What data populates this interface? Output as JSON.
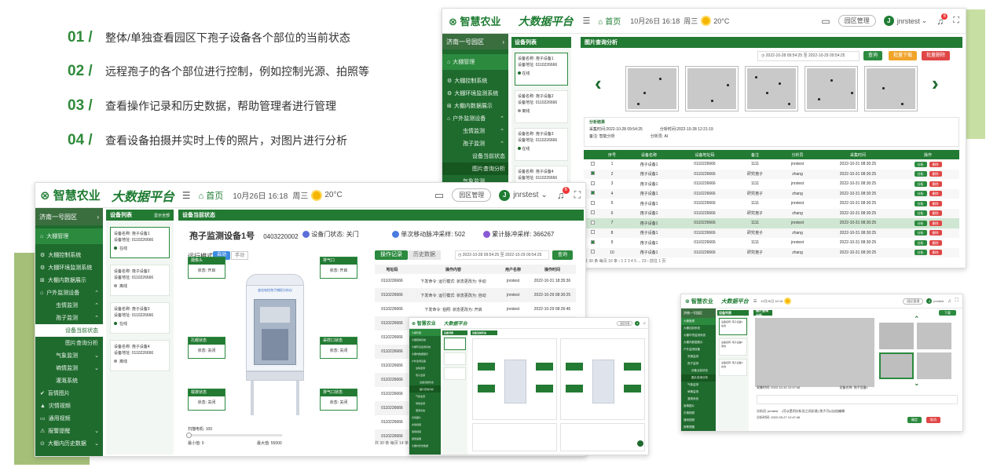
{
  "features": [
    {
      "num": "01 /",
      "text": "整体/单独查看园区下孢子设备各个部位的当前状态"
    },
    {
      "num": "02 /",
      "text": "远程孢子的各个部位进行控制，例如控制光源、拍照等"
    },
    {
      "num": "03 /",
      "text": "查看操作记录和历史数据，帮助管理者进行管理"
    },
    {
      "num": "04 /",
      "text": "查看设备拍摄并实时上传的照片，对图片进行分析"
    }
  ],
  "header": {
    "logo": "智慧农业",
    "platform": "大数据平台",
    "home": "首页",
    "date": "10月26日 16:18",
    "weekday": "周三",
    "temp": "20°C",
    "park_btn": "园区管理",
    "user": "jnrstest",
    "avatar": "J",
    "notify_count": "6"
  },
  "sidebar": {
    "park": "济南一号园区",
    "items": [
      {
        "label": "大棚管理",
        "level": 0
      },
      {
        "label": "大棚控制系统",
        "level": 0
      },
      {
        "label": "大棚环境监测系统",
        "level": 0
      },
      {
        "label": "大棚内数据展示",
        "level": 0
      },
      {
        "label": "户外监测设备",
        "level": 0,
        "arrow": "⌃"
      },
      {
        "label": "虫情监测",
        "level": 1,
        "arrow": "⌃"
      },
      {
        "label": "孢子监测",
        "level": 1,
        "arrow": "⌃"
      },
      {
        "label": "设备当前状态",
        "level": 2
      },
      {
        "label": "图片查询分析",
        "level": 2
      },
      {
        "label": "气象监测",
        "level": 1,
        "arrow": "⌄"
      },
      {
        "label": "墒情监测",
        "level": 1,
        "arrow": "⌄"
      },
      {
        "label": "灌溉系统",
        "level": 1
      },
      {
        "label": "盲情图片",
        "level": 0
      },
      {
        "label": "灾情视频",
        "level": 0
      },
      {
        "label": "通用视频",
        "level": 0
      },
      {
        "label": "报警提醒",
        "level": 0,
        "arrow": "⌄"
      },
      {
        "label": "大棚内历史数据",
        "level": 0,
        "arrow": "⌄"
      }
    ]
  },
  "devices": {
    "title": "设备列表",
    "show_all": "显示全部",
    "items": [
      {
        "name": "设备名称: 孢子设备1",
        "addr": "设备地址: 0110226666",
        "status": "在线",
        "online": true
      },
      {
        "name": "设备名称: 孢子设备2",
        "addr": "设备地址: 0110226666",
        "status": "离线",
        "online": false
      },
      {
        "name": "设备名称: 孢子设备3",
        "addr": "设备地址: 0110226666",
        "status": "在线",
        "online": true
      },
      {
        "name": "设备名称: 孢子设备4",
        "addr": "设备地址: 0110226666",
        "status": "离线",
        "online": false
      }
    ]
  },
  "main": {
    "section_title": "设备当前状态",
    "device_title": "孢子监测设备1号",
    "device_code": "0403220002",
    "door_status": "设备门状态: 关门",
    "steps": "单次移动脉冲采样: 502",
    "total_steps": "累计脉冲采样: 366267",
    "mode_label": "运行模式:",
    "mode_auto": "自动",
    "mode_manual": "手动",
    "device_image_label": "变倍电控孢子捕捉分析仪",
    "boxes": [
      {
        "title": "摄像头",
        "status": "状态: 开启"
      },
      {
        "title": "排气口",
        "status": "状态: 开启"
      },
      {
        "title": "孔眼状态",
        "status": "状态: 关闭"
      },
      {
        "title": "采样口状态",
        "status": "状态: 关闭"
      },
      {
        "title": "载玻状态",
        "status": "状态: 关闭"
      },
      {
        "title": "排气口状态",
        "status": "状态: 关闭"
      }
    ],
    "slider_label": "扫描电机: 100",
    "min_label": "最小值: 0",
    "max_label": "最大值: 55000",
    "tab_ops": "操作记录",
    "tab_history": "历史数据",
    "date_from": "2022-10-28 09:54:25",
    "date_sep": "至",
    "date_to": "2022-10-29 09:54:25",
    "query": "查询",
    "table_headers": [
      "地址码",
      "操作内容",
      "用户名称",
      "操作时间"
    ],
    "table_rows": [
      [
        "0110226666",
        "下发命令: 运行模式: 状态更改为: 手动",
        "jnrstest",
        "2022-10-31 18:35:36"
      ],
      [
        "0110226666",
        "下发命令: 运行模式: 状态更改为: 自动",
        "jnrstest",
        "2022-10-29 08:30:25"
      ],
      [
        "0110226666",
        "下发命令: 拍照: 状态更改为: 开启",
        "jnrstest",
        "2022-10-29 08:26:46"
      ],
      [
        "0110226666",
        "",
        "",
        ""
      ],
      [
        "0110226666",
        "",
        "",
        ""
      ],
      [
        "0110226666",
        "",
        "",
        ""
      ],
      [
        "0110226666",
        "",
        "",
        ""
      ],
      [
        "0110226666",
        "",
        "",
        ""
      ],
      [
        "0110226666",
        "",
        "",
        ""
      ],
      [
        "0110226666",
        "",
        "",
        ""
      ],
      [
        "0110226666",
        "",
        "",
        ""
      ],
      [
        "0110226666",
        "",
        "",
        ""
      ]
    ],
    "pager": "共 30 条   每页 14 条   ‹   1   2  ...  23   ›   前往   1   页"
  },
  "tr": {
    "section_title": "图片查询分析",
    "date_from": "2022-10-28 09:54:25",
    "date_sep": "至",
    "date_to": "2022-10-29 09:54:25",
    "query": "查询",
    "batch_download": "批量下载",
    "batch_delete": "批量删除",
    "result_title": "分析结果",
    "capture_time": "采集时间:2022-10-28 09:54:25",
    "analysis_time": "分析时间:2022-10-28 12:21:19",
    "remark": "备注: 智能分析",
    "analyzer": "分析员: AI",
    "headers": [
      "",
      "序号",
      "设备名称",
      "设备地址码",
      "备注",
      "分析员",
      "采集时间",
      "操作"
    ],
    "rows": [
      {
        "no": "1",
        "dev": "孢子设备1",
        "addr": "0110226666",
        "note": "1111",
        "ana": "jnrstest",
        "time": "2022-10-31 08:30:25",
        "checked": false
      },
      {
        "no": "2",
        "dev": "孢子设备1",
        "addr": "0110226666",
        "note": "研究孢子",
        "ana": "zhang",
        "time": "2022-10-31 08:30:25",
        "checked": true
      },
      {
        "no": "3",
        "dev": "孢子设备1",
        "addr": "0110226666",
        "note": "1111",
        "ana": "jnrstest",
        "time": "2022-10-31 08:30:25",
        "checked": false
      },
      {
        "no": "4",
        "dev": "孢子设备1",
        "addr": "0110226666",
        "note": "研究孢子",
        "ana": "zhang",
        "time": "2022-10-31 08:30:25",
        "checked": true
      },
      {
        "no": "5",
        "dev": "孢子设备1",
        "addr": "0110226666",
        "note": "1111",
        "ana": "jnrstest",
        "time": "2022-10-31 08:30:25",
        "checked": false
      },
      {
        "no": "6",
        "dev": "孢子设备1",
        "addr": "0110226666",
        "note": "研究孢子",
        "ana": "zhang",
        "time": "2022-10-31 08:30:25",
        "checked": false
      },
      {
        "no": "7",
        "dev": "孢子设备1",
        "addr": "0110226666",
        "note": "1111",
        "ana": "jnrstest",
        "time": "2022-10-31 08:30:25",
        "checked": false
      },
      {
        "no": "8",
        "dev": "孢子设备1",
        "addr": "0110226666",
        "note": "研究孢子",
        "ana": "zhang",
        "time": "2022-10-31 08:30:25",
        "checked": false
      },
      {
        "no": "9",
        "dev": "孢子设备1",
        "addr": "0110226666",
        "note": "1111",
        "ana": "jnrstest",
        "time": "2022-10-31 08:30:25",
        "checked": true
      },
      {
        "no": "10",
        "dev": "孢子设备1",
        "addr": "0110226666",
        "note": "研究孢子",
        "ana": "zhang",
        "time": "2022-10-31 08:30:25",
        "checked": false
      }
    ],
    "btn_analyze": "分析",
    "btn_delete": "删除",
    "pager": "共 30 条  每页 10 条   ‹   1   2   3   4   5  ...  23   ›   前往   1   页"
  },
  "br": {
    "section_title": "图片查询分析",
    "download": "下载",
    "capture_time": "采集时间: 2022-10-31 12:47:46",
    "device": "设备名称: 孢子设备1",
    "analyst_label": "分析员:",
    "analyst": "jnrstest",
    "note": "(可以是同分析员之间反馈) 孢子可以自由编辑",
    "analysis_time": "分析时间: 2022-09-27 12:47:46",
    "btn_ok": "确定",
    "btn_cancel": "取消"
  },
  "bm": {
    "title": "设备当前状态"
  },
  "colors": {
    "brand": "#1e7c32",
    "sidebar": "#1f6b2e",
    "accent": "#2b8a3e",
    "warn": "#f0a429",
    "danger": "#e04646"
  },
  "icons": [
    "menu-icon",
    "home-icon",
    "sun-icon",
    "monitor-icon",
    "bell-icon",
    "fullscreen-icon",
    "chevron-left-icon",
    "chevron-right-icon",
    "calendar-icon"
  ]
}
